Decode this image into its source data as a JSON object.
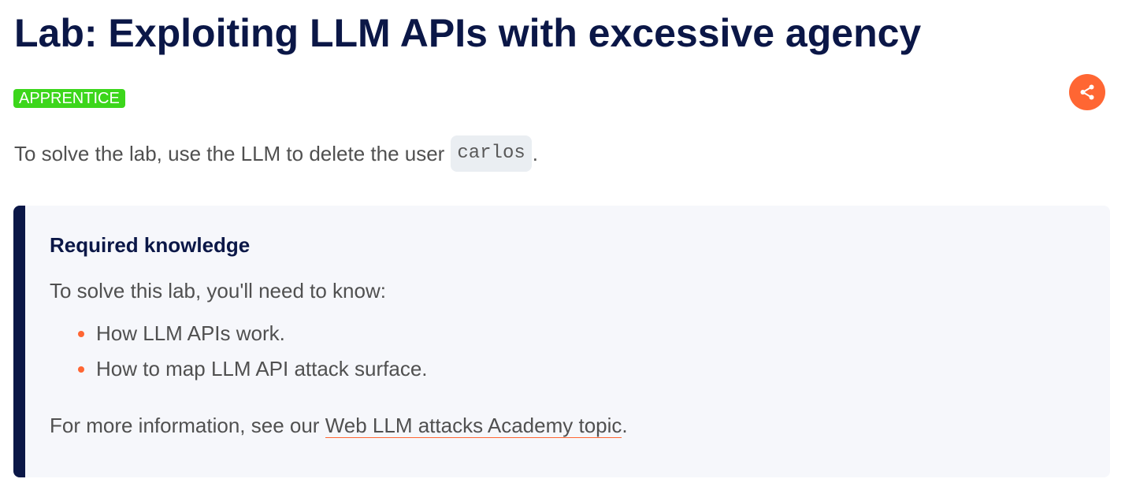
{
  "title": "Lab: Exploiting LLM APIs with excessive agency",
  "badge": "APPRENTICE",
  "intro": {
    "before": "To solve the lab, use the LLM to delete the user",
    "code": "carlos",
    "after": "."
  },
  "callout": {
    "heading": "Required knowledge",
    "lead": "To solve this lab, you'll need to know:",
    "items": [
      "How LLM APIs work.",
      "How to map LLM API attack surface."
    ],
    "footer": {
      "before": "For more information, see our ",
      "link": "Web LLM attacks Academy topic",
      "after": "."
    }
  },
  "colors": {
    "title": "#0b1747",
    "badge": "#3cd61b",
    "accent": "#ff6633",
    "callout_bg": "#f6f7fb",
    "callout_bar": "#0b1747"
  },
  "icons": {
    "share": "share-icon"
  }
}
